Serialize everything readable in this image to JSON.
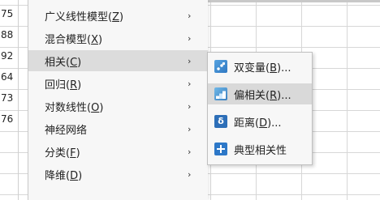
{
  "sheet": {
    "visible_values": [
      "75",
      "88",
      "92",
      "64",
      "73",
      "76"
    ]
  },
  "main_menu": {
    "items": [
      {
        "text": "广义线性模型(",
        "key": "Z",
        "tail": ")",
        "has_submenu": true,
        "active": false
      },
      {
        "text": "混合模型(",
        "key": "X",
        "tail": ")",
        "has_submenu": true,
        "active": false
      },
      {
        "text": "相关(",
        "key": "C",
        "tail": ")",
        "has_submenu": true,
        "active": true
      },
      {
        "text": "回归(",
        "key": "R",
        "tail": ")",
        "has_submenu": true,
        "active": false
      },
      {
        "text": "对数线性(",
        "key": "O",
        "tail": ")",
        "has_submenu": true,
        "active": false
      },
      {
        "text": "神经网络",
        "key": "",
        "tail": "",
        "has_submenu": true,
        "active": false
      },
      {
        "text": "分类(",
        "key": "F",
        "tail": ")",
        "has_submenu": true,
        "active": false
      },
      {
        "text": "降维(",
        "key": "D",
        "tail": ")",
        "has_submenu": true,
        "active": false
      }
    ],
    "arrow": "›"
  },
  "sub_menu": {
    "items": [
      {
        "icon": "bivariate-icon",
        "text": "双变量(",
        "key": "B",
        "tail": ")...",
        "active": false
      },
      {
        "icon": "partial-icon",
        "text": "偏相关(",
        "key": "R",
        "tail": ")...",
        "active": true
      },
      {
        "icon": "distance-icon",
        "icon_glyph": "δ",
        "text": "距离(",
        "key": "D",
        "tail": ")...",
        "active": false
      },
      {
        "icon": "canonical-correlation-icon",
        "text": "典型相关性",
        "key": "",
        "tail": "",
        "active": false
      }
    ]
  },
  "colors": {
    "menu_bg": "#f7f7f7",
    "highlight": "#dcdcdc",
    "icon_blue": "#2d78c8"
  }
}
